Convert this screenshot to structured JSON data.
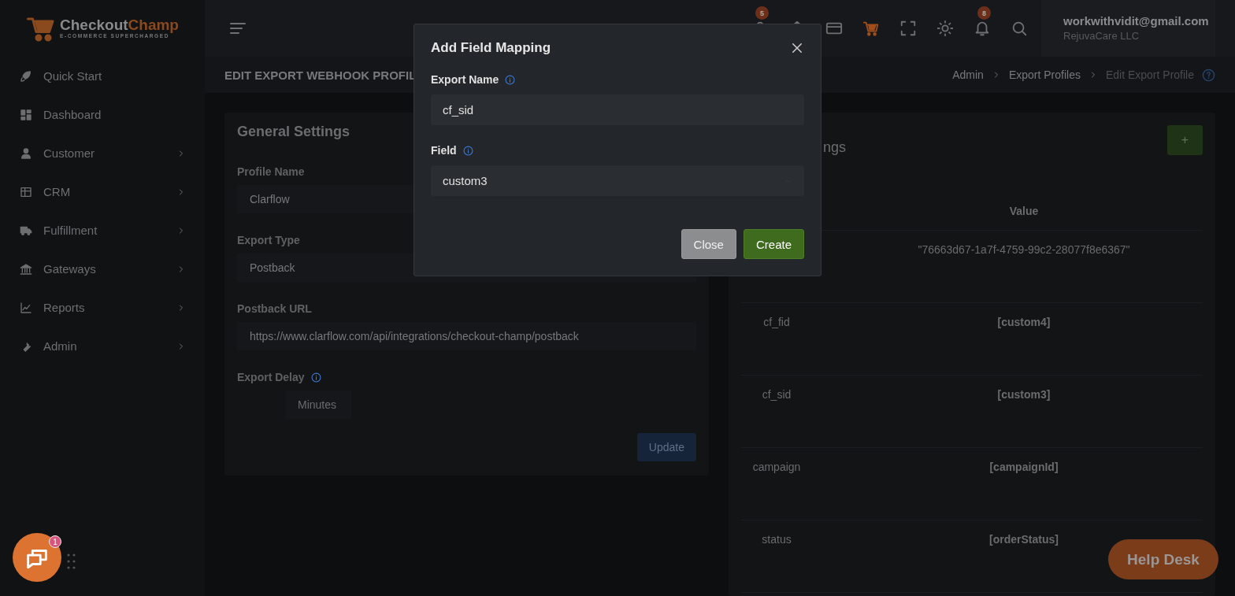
{
  "brand": {
    "name_first": "Checkout",
    "name_second": "Champ",
    "tagline": "E-COMMERCE SUPERCHARGED"
  },
  "sidebar": {
    "items": [
      {
        "label": "Quick Start",
        "expandable": false
      },
      {
        "label": "Dashboard",
        "expandable": false
      },
      {
        "label": "Customer",
        "expandable": true
      },
      {
        "label": "CRM",
        "expandable": true
      },
      {
        "label": "Fulfillment",
        "expandable": true
      },
      {
        "label": "Gateways",
        "expandable": true
      },
      {
        "label": "Reports",
        "expandable": true
      },
      {
        "label": "Admin",
        "expandable": true
      }
    ]
  },
  "header": {
    "icons": [
      {
        "kind": "user",
        "badge": "5"
      },
      {
        "kind": "home"
      },
      {
        "kind": "card"
      },
      {
        "kind": "cart"
      },
      {
        "kind": "fullscreen"
      },
      {
        "kind": "sun"
      },
      {
        "kind": "bell",
        "badge": "8"
      },
      {
        "kind": "search"
      }
    ],
    "user": {
      "email": "workwithvidit@gmail.com",
      "company": "RejuvaCare LLC"
    }
  },
  "page_title": "EDIT EXPORT WEBHOOK PROFIL",
  "breadcrumbs": [
    {
      "label": "Admin",
      "current": false
    },
    {
      "label": "Export Profiles",
      "current": false
    },
    {
      "label": "Edit Export Profile",
      "current": true
    }
  ],
  "general_settings": {
    "title": "General Settings",
    "fields": [
      {
        "label": "Profile Name",
        "kind": "input",
        "value": "Clarflow",
        "info": false
      },
      {
        "label": "Export Type",
        "kind": "select",
        "value": "Postback",
        "info": false
      },
      {
        "label": "Postback URL",
        "kind": "input",
        "value": "https://www.clarflow.com/api/integrations/checkout-champ/postback",
        "info": false
      },
      {
        "label": "Export Delay",
        "kind": "addon",
        "value": "Minutes",
        "info": true
      }
    ],
    "button": "Update"
  },
  "field_mappings": {
    "title": "ngs",
    "add_button": "+",
    "columns": [
      "Value"
    ],
    "rows": [
      {
        "value": "\"76663d67-1a7f-4759-99c2-28077f8e6367\"",
        "kind": "literal"
      },
      {
        "name": "cf_fid",
        "value": "[custom4]",
        "kind": "field"
      },
      {
        "name": "cf_sid",
        "value": "[custom3]",
        "kind": "field"
      },
      {
        "name": "campaign",
        "value": "[campaignId]",
        "kind": "field"
      },
      {
        "name": "status",
        "value": "[orderStatus]",
        "kind": "field"
      }
    ]
  },
  "modal": {
    "title": "Add Field Mapping",
    "fields": [
      {
        "label": "Export Name",
        "info": true,
        "kind": "input",
        "value": "cf_sid"
      },
      {
        "label": "Field",
        "info": true,
        "kind": "select",
        "value": "custom3"
      }
    ],
    "buttons": [
      {
        "label": "Close",
        "kind": "secondary"
      },
      {
        "label": "Create",
        "kind": "primary"
      }
    ]
  },
  "chat": {
    "badge": "1"
  },
  "help_desk": "Help Desk"
}
